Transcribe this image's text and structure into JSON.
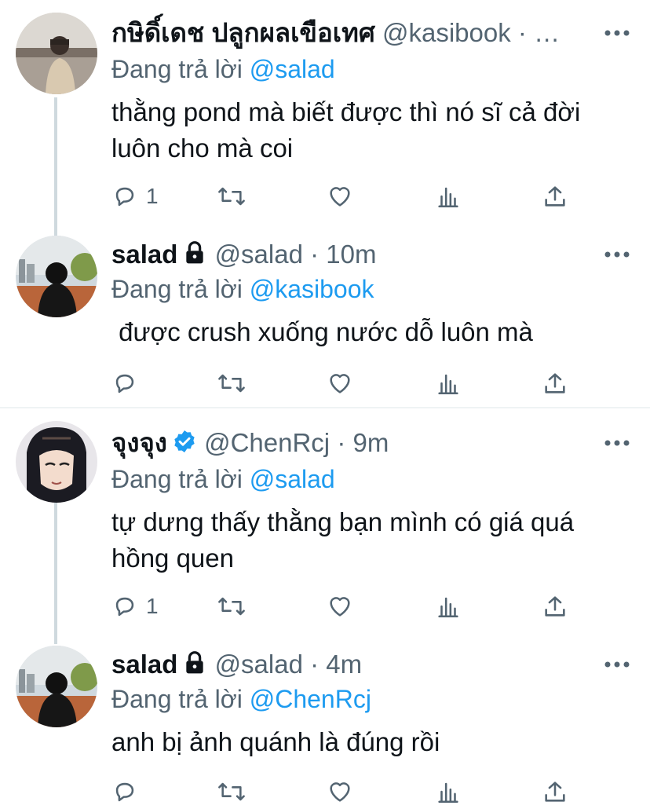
{
  "tweets": [
    {
      "name": "กษิดิ์เดช ปลูกผลเขือเทศ",
      "handle": "@kasibook",
      "sep": "·",
      "time": "…",
      "reply_prefix": "Đang trả lời",
      "reply_to": "@salad",
      "text": "thằng pond mà biết được thì nó sĩ cả đời luôn cho mà coi",
      "reply_count": "1",
      "locked": false,
      "verified": false
    },
    {
      "name": "salad",
      "handle": "@salad",
      "sep": "·",
      "time": "10m",
      "reply_prefix": "Đang trả lời",
      "reply_to": "@kasibook",
      "text": " được crush xuống nước dỗ luôn mà",
      "reply_count": "",
      "locked": true,
      "verified": false
    },
    {
      "name": "จุงจุง",
      "handle": "@ChenRcj",
      "sep": "·",
      "time": "9m",
      "reply_prefix": "Đang trả lời",
      "reply_to": "@salad",
      "text": "tự dưng thấy thằng bạn mình có giá quá hồng quen",
      "reply_count": "1",
      "locked": false,
      "verified": true
    },
    {
      "name": "salad",
      "handle": "@salad",
      "sep": "·",
      "time": "4m",
      "reply_prefix": "Đang trả lời",
      "reply_to": "@ChenRcj",
      "text": "anh bị ảnh quánh là đúng rồi",
      "reply_count": "",
      "locked": true,
      "verified": false
    }
  ],
  "icons": {
    "reply": "reply-icon",
    "retweet": "retweet-icon",
    "like": "like-icon",
    "analytics": "analytics-icon",
    "share": "share-icon",
    "more": "more-icon",
    "lock": "lock-icon",
    "verified": "verified-badge-icon"
  },
  "colors": {
    "link": "#1d9bf0",
    "secondary": "#536471",
    "thread_line": "#cfd9de"
  }
}
